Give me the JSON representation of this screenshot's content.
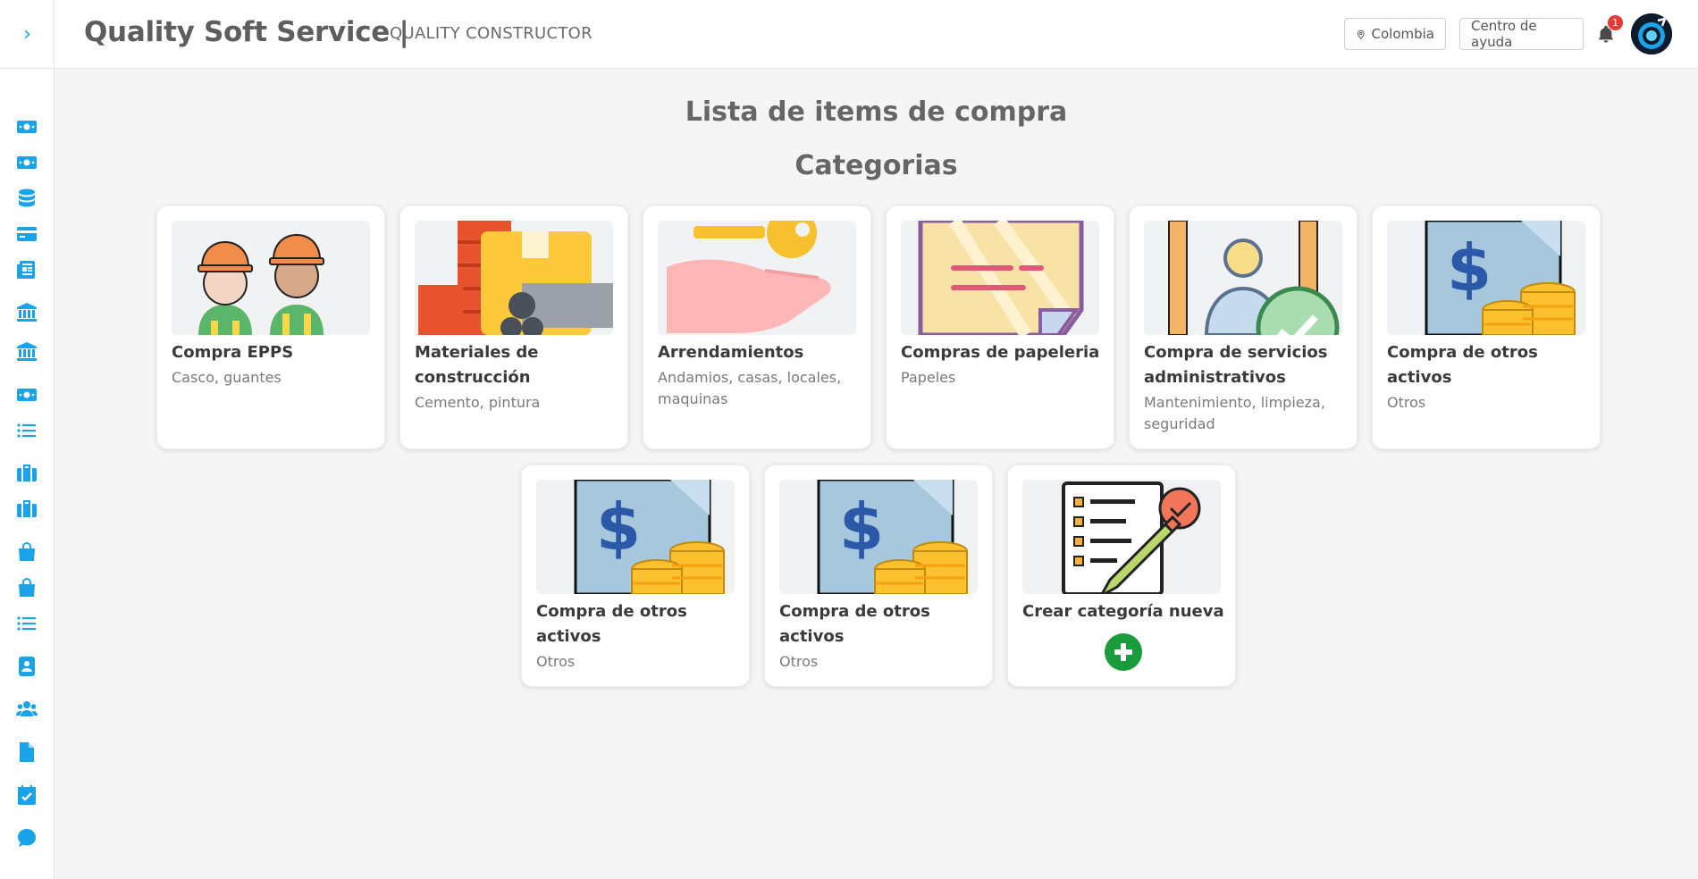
{
  "header": {
    "brand": "Quality Soft Service |",
    "company": "QUALITY CONSTRUCTOR",
    "country": "Colombia",
    "help": "Centro de ayuda",
    "notifications": "1"
  },
  "page": {
    "title": "Lista de items de compra",
    "section": "Categorias"
  },
  "sidebar": {
    "toggle": "›",
    "icons": [
      "money-icon",
      "money-icon",
      "database-icon",
      "card-icon",
      "newspaper-icon",
      "bank-icon",
      "bank-icon",
      "money-icon",
      "list-icon",
      "briefcase-icon",
      "briefcase-icon",
      "bag-icon",
      "bag-icon",
      "list-icon",
      "contact-book-icon",
      "users-icon",
      "file-icon",
      "calendar-check-icon",
      "chat-icon"
    ]
  },
  "categories": [
    {
      "title": "Compra EPPS",
      "desc": "Casco, guantes",
      "image": "workers-icon"
    },
    {
      "title": "Materiales de construcción",
      "desc": "Cemento, pintura",
      "image": "materials-icon"
    },
    {
      "title": "Arrendamientos",
      "desc": "Andamios, casas, locales, maquinas",
      "image": "rent-key-icon"
    },
    {
      "title": "Compras de papeleria",
      "desc": "Papeles",
      "image": "paper-icon"
    },
    {
      "title": "Compra de servicios administrativos",
      "desc": "Mantenimiento, limpieza, seguridad",
      "image": "admin-services-icon"
    },
    {
      "title": "Compra de otros activos",
      "desc": "Otros",
      "image": "dollar-coins-icon"
    },
    {
      "title": "Compra de otros activos",
      "desc": "Otros",
      "image": "dollar-coins-icon"
    },
    {
      "title": "Compra de otros activos",
      "desc": "Otros",
      "image": "dollar-coins-icon"
    }
  ],
  "new_category": {
    "title": "Crear categoría nueva",
    "image": "checklist-pencil-icon"
  },
  "colors": {
    "accent": "#1aa3e8",
    "add": "#1a9b3c",
    "badge": "#e53935"
  }
}
